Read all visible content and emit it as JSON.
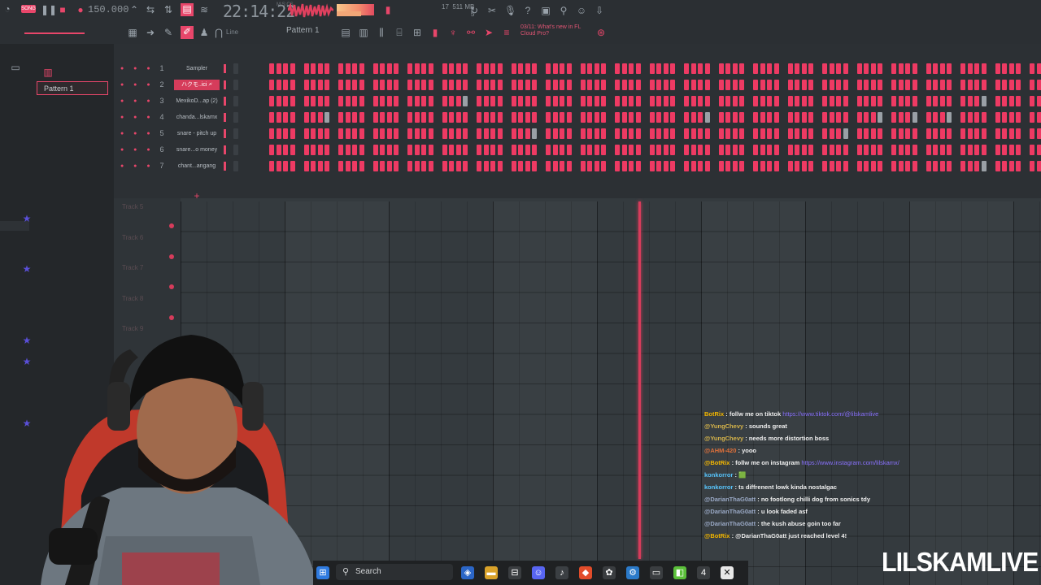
{
  "toolbar": {
    "tempo": "150.000",
    "clock": "22:14:22",
    "clock_small": "M:S:CS",
    "memory": "17  511 MB\n5",
    "pattern_selector": "Pattern 1",
    "snap_mode": "Line",
    "news": "03/11: What's new in FL Cloud Pro?"
  },
  "browser": {
    "pattern_label": "Pattern 1"
  },
  "channel_rack": {
    "channels": [
      {
        "num": "1",
        "name": "Sampler",
        "selected": false
      },
      {
        "num": "2",
        "name": "ハクモ..ici 🗲",
        "selected": true
      },
      {
        "num": "3",
        "name": "MexikoD...ap (2)",
        "selected": false
      },
      {
        "num": "4",
        "name": "chanda...lskamx",
        "selected": false
      },
      {
        "num": "5",
        "name": "snare - pitch up",
        "selected": false
      },
      {
        "num": "6",
        "name": "snare...o money",
        "selected": false
      },
      {
        "num": "7",
        "name": "chant...angang",
        "selected": false
      }
    ]
  },
  "playlist": {
    "tracks": [
      "Track 5",
      "Track 6",
      "Track 7",
      "Track 8",
      "Track 9"
    ]
  },
  "chat": [
    {
      "user": "BotRix",
      "text": "follw me on tiktok",
      "link": "https://www.tiktok.com/@lilskamlive",
      "color": "#f5b800"
    },
    {
      "user": "@YungChevy",
      "text": "sounds great",
      "link": "",
      "color": "#d6b44a"
    },
    {
      "user": "@YungChevy",
      "text": "needs more distortion boss",
      "link": "",
      "color": "#d6b44a"
    },
    {
      "user": "@AHM-420",
      "text": "yooo",
      "link": "",
      "color": "#e0703a"
    },
    {
      "user": "@BotRix",
      "text": "follw me on instagram",
      "link": "https://www.instagram.com/lilskamx/",
      "color": "#f5b800"
    },
    {
      "user": "konkorror",
      "text": "🟩",
      "link": "",
      "color": "#58c7ff"
    },
    {
      "user": "konkorror",
      "text": "ts diffrenent lowk kinda nostalgac",
      "link": "",
      "color": "#58c7ff"
    },
    {
      "user": "@DarianThaG0att",
      "text": "no footlong chilli dog from sonics tdy",
      "link": "",
      "color": "#9aa9c6"
    },
    {
      "user": "@DarianThaG0att",
      "text": "u look faded asf",
      "link": "",
      "color": "#9aa9c6"
    },
    {
      "user": "@DarianThaG0att",
      "text": "the kush abuse goin too far",
      "link": "",
      "color": "#9aa9c6"
    },
    {
      "user": "@BotRix",
      "text": "@DarianThaG0att just reached level 4!",
      "link": "",
      "color": "#f5b800"
    }
  ],
  "taskbar": {
    "search_label": "Search"
  },
  "overlay": {
    "brand": "LILSKAMLIVE"
  },
  "colors": {
    "accent": "#e8466a",
    "step_on": "#ee3a63",
    "step_off": "#3a3f44",
    "playhead": "#d63c5b"
  }
}
